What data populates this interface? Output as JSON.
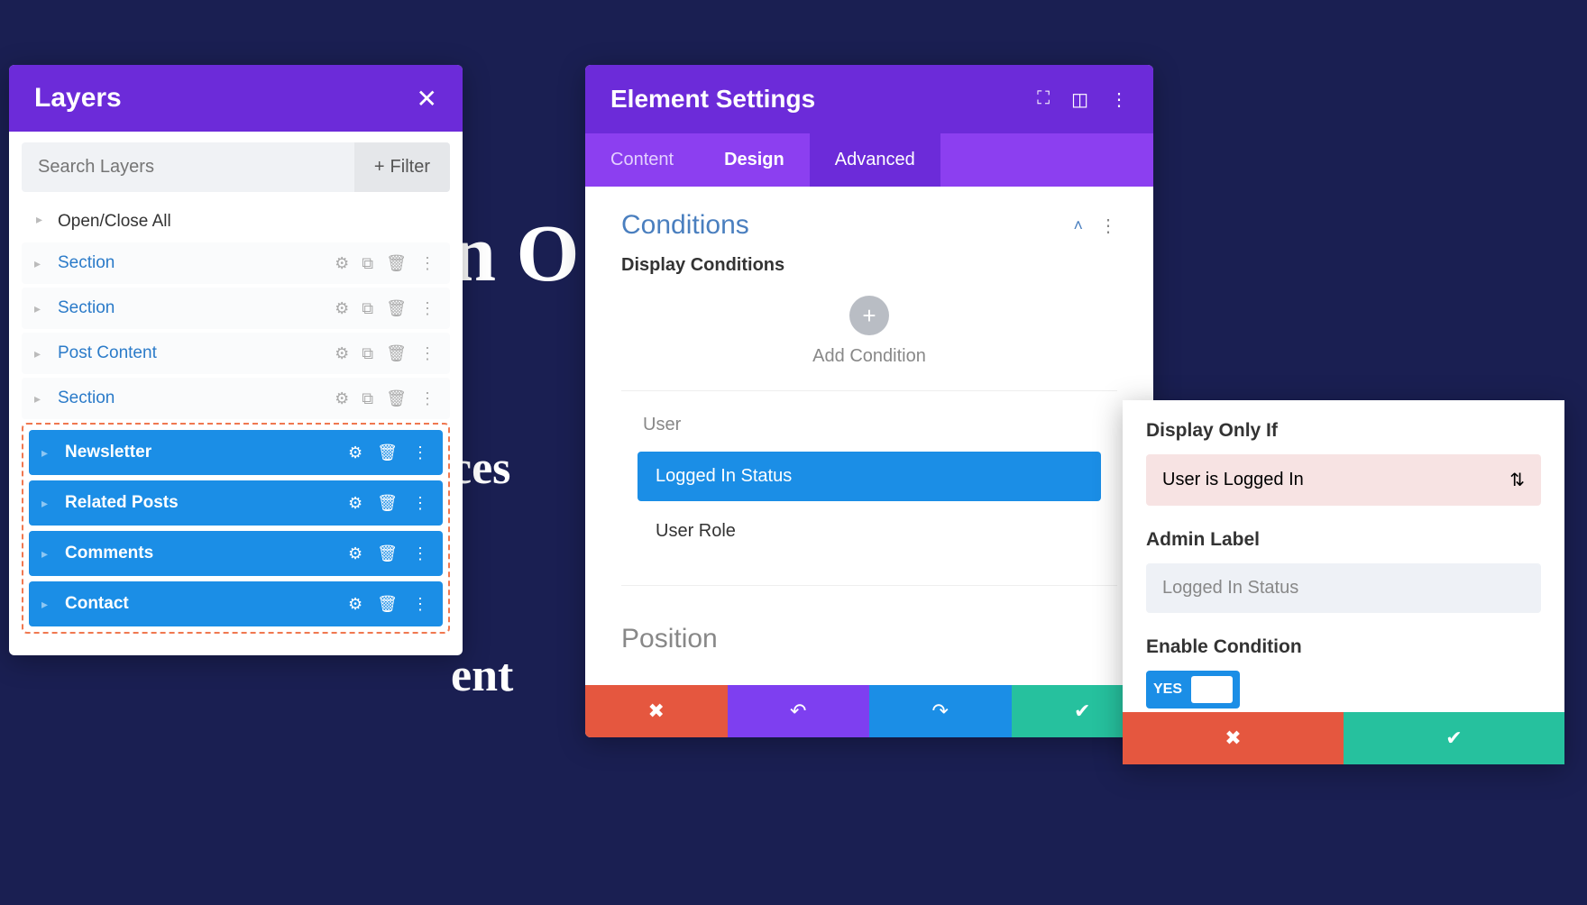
{
  "background": {
    "line1": "n O          r",
    "line2": "ces",
    "line3": "ent"
  },
  "layers": {
    "title": "Layers",
    "search_placeholder": "Search Layers",
    "filter_label": "Filter",
    "open_close_all": "Open/Close All",
    "items": [
      {
        "label": "Section"
      },
      {
        "label": "Section"
      },
      {
        "label": "Post Content"
      },
      {
        "label": "Section"
      }
    ],
    "selected": [
      {
        "label": "Newsletter"
      },
      {
        "label": "Related Posts"
      },
      {
        "label": "Comments"
      },
      {
        "label": "Contact"
      }
    ]
  },
  "settings": {
    "title": "Element Settings",
    "tabs": {
      "content": "Content",
      "design": "Design",
      "advanced": "Advanced"
    },
    "conditions": {
      "heading": "Conditions",
      "display_label": "Display Conditions",
      "add_label": "Add Condition",
      "group_label": "User",
      "options": [
        {
          "label": "Logged In Status",
          "active": true
        },
        {
          "label": "User Role",
          "active": false
        }
      ]
    },
    "position_heading": "Position"
  },
  "cond_detail": {
    "display_only_if": "Display Only If",
    "display_value": "User is Logged In",
    "admin_label": "Admin Label",
    "admin_value": "Logged In Status",
    "enable_label": "Enable Condition",
    "toggle_text": "YES"
  }
}
